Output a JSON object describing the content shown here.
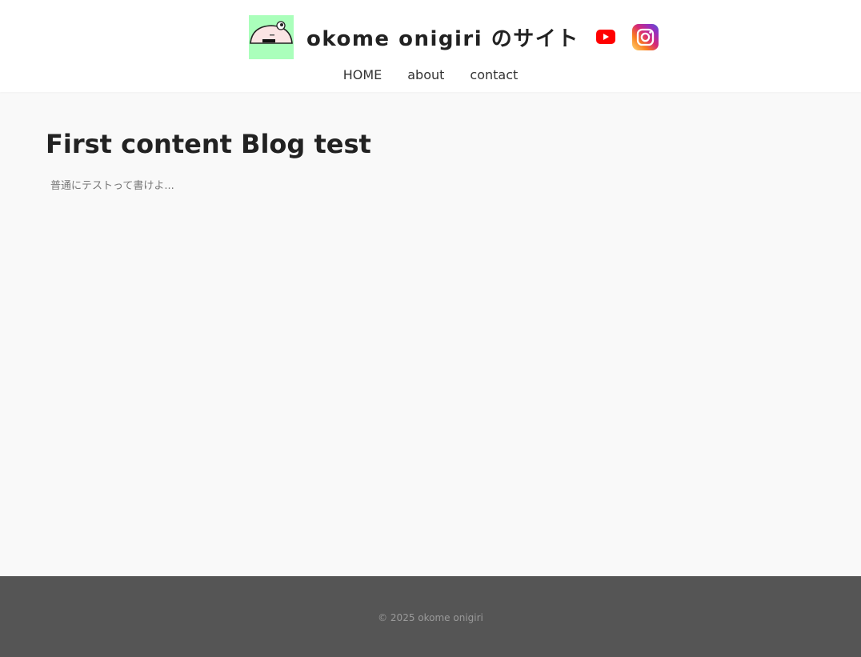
{
  "header": {
    "site_title": "okome onigiri のサイト",
    "logo_bg_color": "#aaffbb",
    "social": [
      {
        "name": "youtube-icon",
        "color": "#ff0000"
      },
      {
        "name": "instagram-icon",
        "colors": [
          "#feda75",
          "#fa7e1e",
          "#d62976",
          "#962fbf",
          "#4f5bd5"
        ]
      }
    ]
  },
  "nav": {
    "items": [
      {
        "label": "HOME"
      },
      {
        "label": "about"
      },
      {
        "label": "contact"
      }
    ]
  },
  "main": {
    "post_title": "First content Blog test",
    "post_excerpt": "普通にテストって書けよ..."
  },
  "footer": {
    "copyright": "© 2025 okome onigiri",
    "bg_color": "#555555"
  }
}
